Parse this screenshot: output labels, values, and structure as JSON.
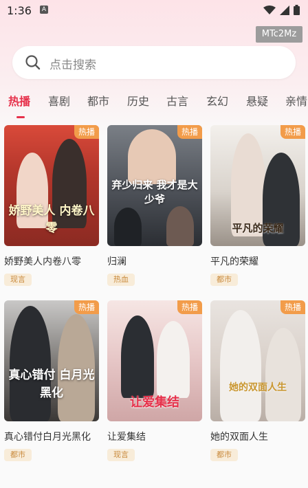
{
  "status_bar": {
    "time": "1:36",
    "notification_letter": "A"
  },
  "overlay_id": "MTc2Mz",
  "search": {
    "placeholder": "点击搜索"
  },
  "tabs": [
    {
      "label": "热播",
      "active": true
    },
    {
      "label": "喜剧"
    },
    {
      "label": "都市"
    },
    {
      "label": "历史"
    },
    {
      "label": "古言"
    },
    {
      "label": "玄幻"
    },
    {
      "label": "悬疑"
    },
    {
      "label": "亲情"
    }
  ],
  "badge_label": "热播",
  "cards": [
    {
      "title": "娇野美人内卷八零",
      "tag": "现言",
      "poster_text": "娇野美人 内卷八零"
    },
    {
      "title": "归澜",
      "tag": "热血",
      "poster_text": "弃少归来 我才是大少爷"
    },
    {
      "title": "平凡的荣耀",
      "tag": "都市",
      "poster_text": "平凡的荣耀"
    },
    {
      "title": "真心错付白月光黑化",
      "tag": "都市",
      "poster_text": "真心错付 白月光黑化"
    },
    {
      "title": "让爱集结",
      "tag": "现言",
      "poster_text": "让爱集结"
    },
    {
      "title": "她的双面人生",
      "tag": "都市",
      "poster_text": "她的双面人生"
    }
  ],
  "colors": {
    "accent": "#e6304a",
    "hot_badge": "#f29c4a",
    "tag_bg": "#f8ecd9",
    "tag_text": "#c98a3c"
  }
}
